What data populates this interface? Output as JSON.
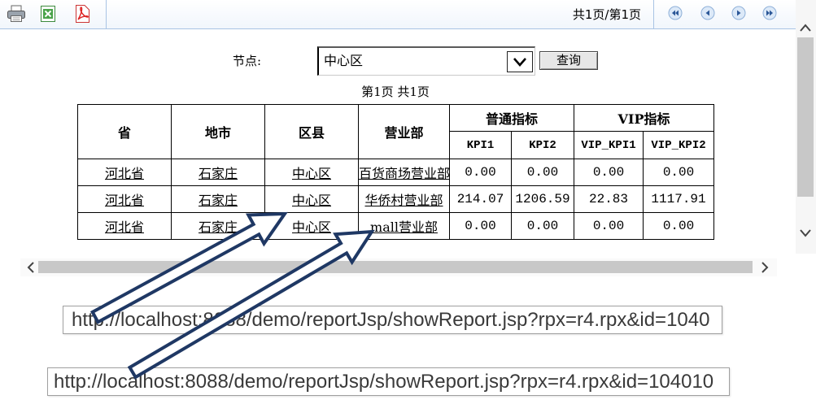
{
  "toolbar": {
    "print_icon": "printer-icon",
    "excel_icon": "excel-icon",
    "pdf_icon": "pdf-icon",
    "page_info": "共1页/第1页",
    "nav_icons": [
      "first-page-icon",
      "prev-page-icon",
      "next-page-icon",
      "last-page-icon"
    ]
  },
  "query": {
    "node_label": "节点:",
    "node_selected": "中心区",
    "submit_label": "查询"
  },
  "page_status": "第1页 共1页",
  "report": {
    "headers": {
      "province": "省",
      "city": "地市",
      "district": "区县",
      "branch": "营业部",
      "normal_group": "普通指标",
      "vip_group": "VIP指标",
      "kpi1": "KPI1",
      "kpi2": "KPI2",
      "vip_kpi1": "VIP_KPI1",
      "vip_kpi2": "VIP_KPI2"
    },
    "rows": [
      {
        "province": "河北省",
        "city": "石家庄",
        "district": "中心区",
        "branch": "百货商场营业部",
        "kpi1": "0.00",
        "kpi2": "0.00",
        "vip_kpi1": "0.00",
        "vip_kpi2": "0.00"
      },
      {
        "province": "河北省",
        "city": "石家庄",
        "district": "中心区",
        "branch": "华侨村营业部",
        "kpi1": "214.07",
        "kpi2": "1206.59",
        "vip_kpi1": "22.83",
        "vip_kpi2": "1117.91"
      },
      {
        "province": "河北省",
        "city": "石家庄",
        "district": "中心区",
        "branch": "mall营业部",
        "kpi1": "0.00",
        "kpi2": "0.00",
        "vip_kpi1": "0.00",
        "vip_kpi2": "0.00"
      }
    ]
  },
  "annotations": {
    "url_district": "http://localhost:8088/demo/reportJsp/showReport.jsp?rpx=r4.rpx&id=1040",
    "url_branch": "http://localhost:8088/demo/reportJsp/showReport.jsp?rpx=r4.rpx&id=104010"
  },
  "colors": {
    "arrow": "#1f3864",
    "toolbar_border": "#a9c4e4",
    "nav_button": "#dce9f8",
    "nav_glyph": "#2b5797",
    "scroll_thumb": "#c8c8c8"
  }
}
